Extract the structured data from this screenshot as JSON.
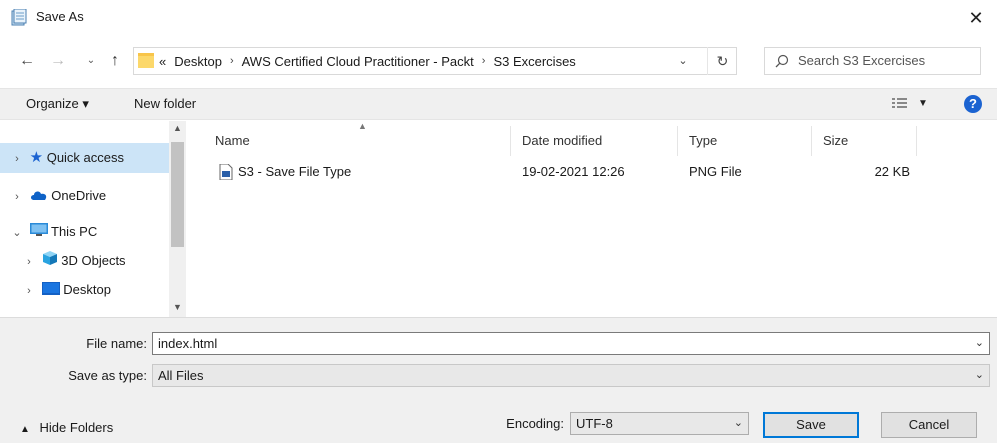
{
  "window": {
    "title": "Save As",
    "close": "✕"
  },
  "nav": {
    "back": "←",
    "forward": "→",
    "recent": "⌄",
    "up": "↑",
    "breadcrumb": [
      "«",
      "Desktop",
      "AWS Certified Cloud Practitioner - Packt",
      "S3 Excercises"
    ],
    "separator": "›",
    "refresh": "↻"
  },
  "search": {
    "placeholder": "Search S3 Excercises"
  },
  "commandbar": {
    "organize": "Organize ▾",
    "new_folder": "New folder",
    "help": "?"
  },
  "sidebar": {
    "items": [
      {
        "label": "Quick access",
        "chevron": "›",
        "icon": "star-icon",
        "selected": true
      },
      {
        "label": "OneDrive",
        "chevron": "›",
        "icon": "cloud-icon"
      },
      {
        "label": "This PC",
        "chevron": "⌄",
        "icon": "monitor-icon"
      },
      {
        "label": "3D Objects",
        "chevron": "›",
        "icon": "cube-icon"
      },
      {
        "label": "Desktop",
        "chevron": "›",
        "icon": "desktop-icon"
      }
    ]
  },
  "filelist": {
    "columns": [
      "Name",
      "Date modified",
      "Type",
      "Size"
    ],
    "rows": [
      {
        "name": "S3 - Save File Type",
        "date": "19-02-2021 12:26",
        "type": "PNG File",
        "size": "22 KB"
      }
    ]
  },
  "form": {
    "filename_label": "File name:",
    "filename_value": "index.html",
    "savetype_label": "Save as type:",
    "savetype_value": "All Files",
    "encoding_label": "Encoding:",
    "encoding_value": "UTF-8"
  },
  "buttons": {
    "hide_folders": "Hide Folders",
    "save": "Save",
    "cancel": "Cancel"
  },
  "colors": {
    "accent": "#0078d7",
    "selection": "#cce4f7",
    "help": "#1b63d1",
    "folder": "#f8c54a"
  }
}
